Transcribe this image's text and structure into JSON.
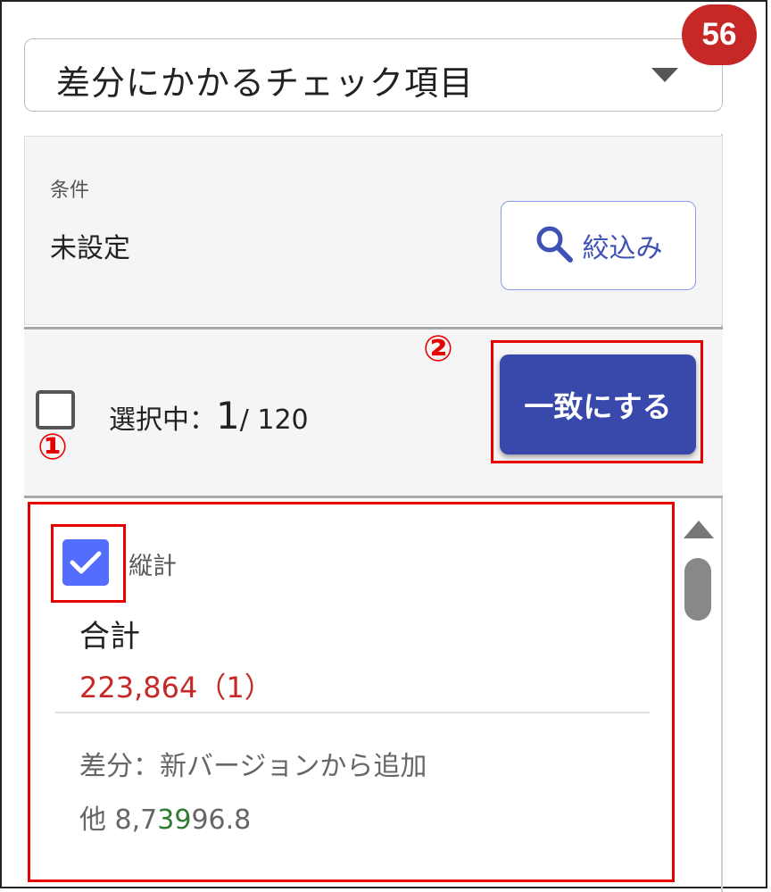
{
  "dropdown": {
    "label": "差分にかかるチェック項目",
    "badge": "56"
  },
  "filter": {
    "condition_label": "条件",
    "condition_value": "未設定",
    "button_label": "絞込み"
  },
  "selection": {
    "label": "選択中：",
    "count": "1",
    "total": "/ 120",
    "match_button": "一致にする"
  },
  "annotations": {
    "one": "①",
    "two": "②"
  },
  "card": {
    "tag": "縦計",
    "title": "合計",
    "amount": "223,864（1）",
    "diff": "差分：新バージョンから追加",
    "other_prefix": "他 8,7",
    "other_highlight": "39",
    "other_suffix": "96.8"
  },
  "icons": [
    "chevron-down-icon",
    "search-icon",
    "check-icon",
    "scroll-up-icon"
  ],
  "colors": {
    "primary": "#3949ab",
    "badge": "#c62828",
    "annotation": "#e60000",
    "checkbox": "#536dfe"
  }
}
